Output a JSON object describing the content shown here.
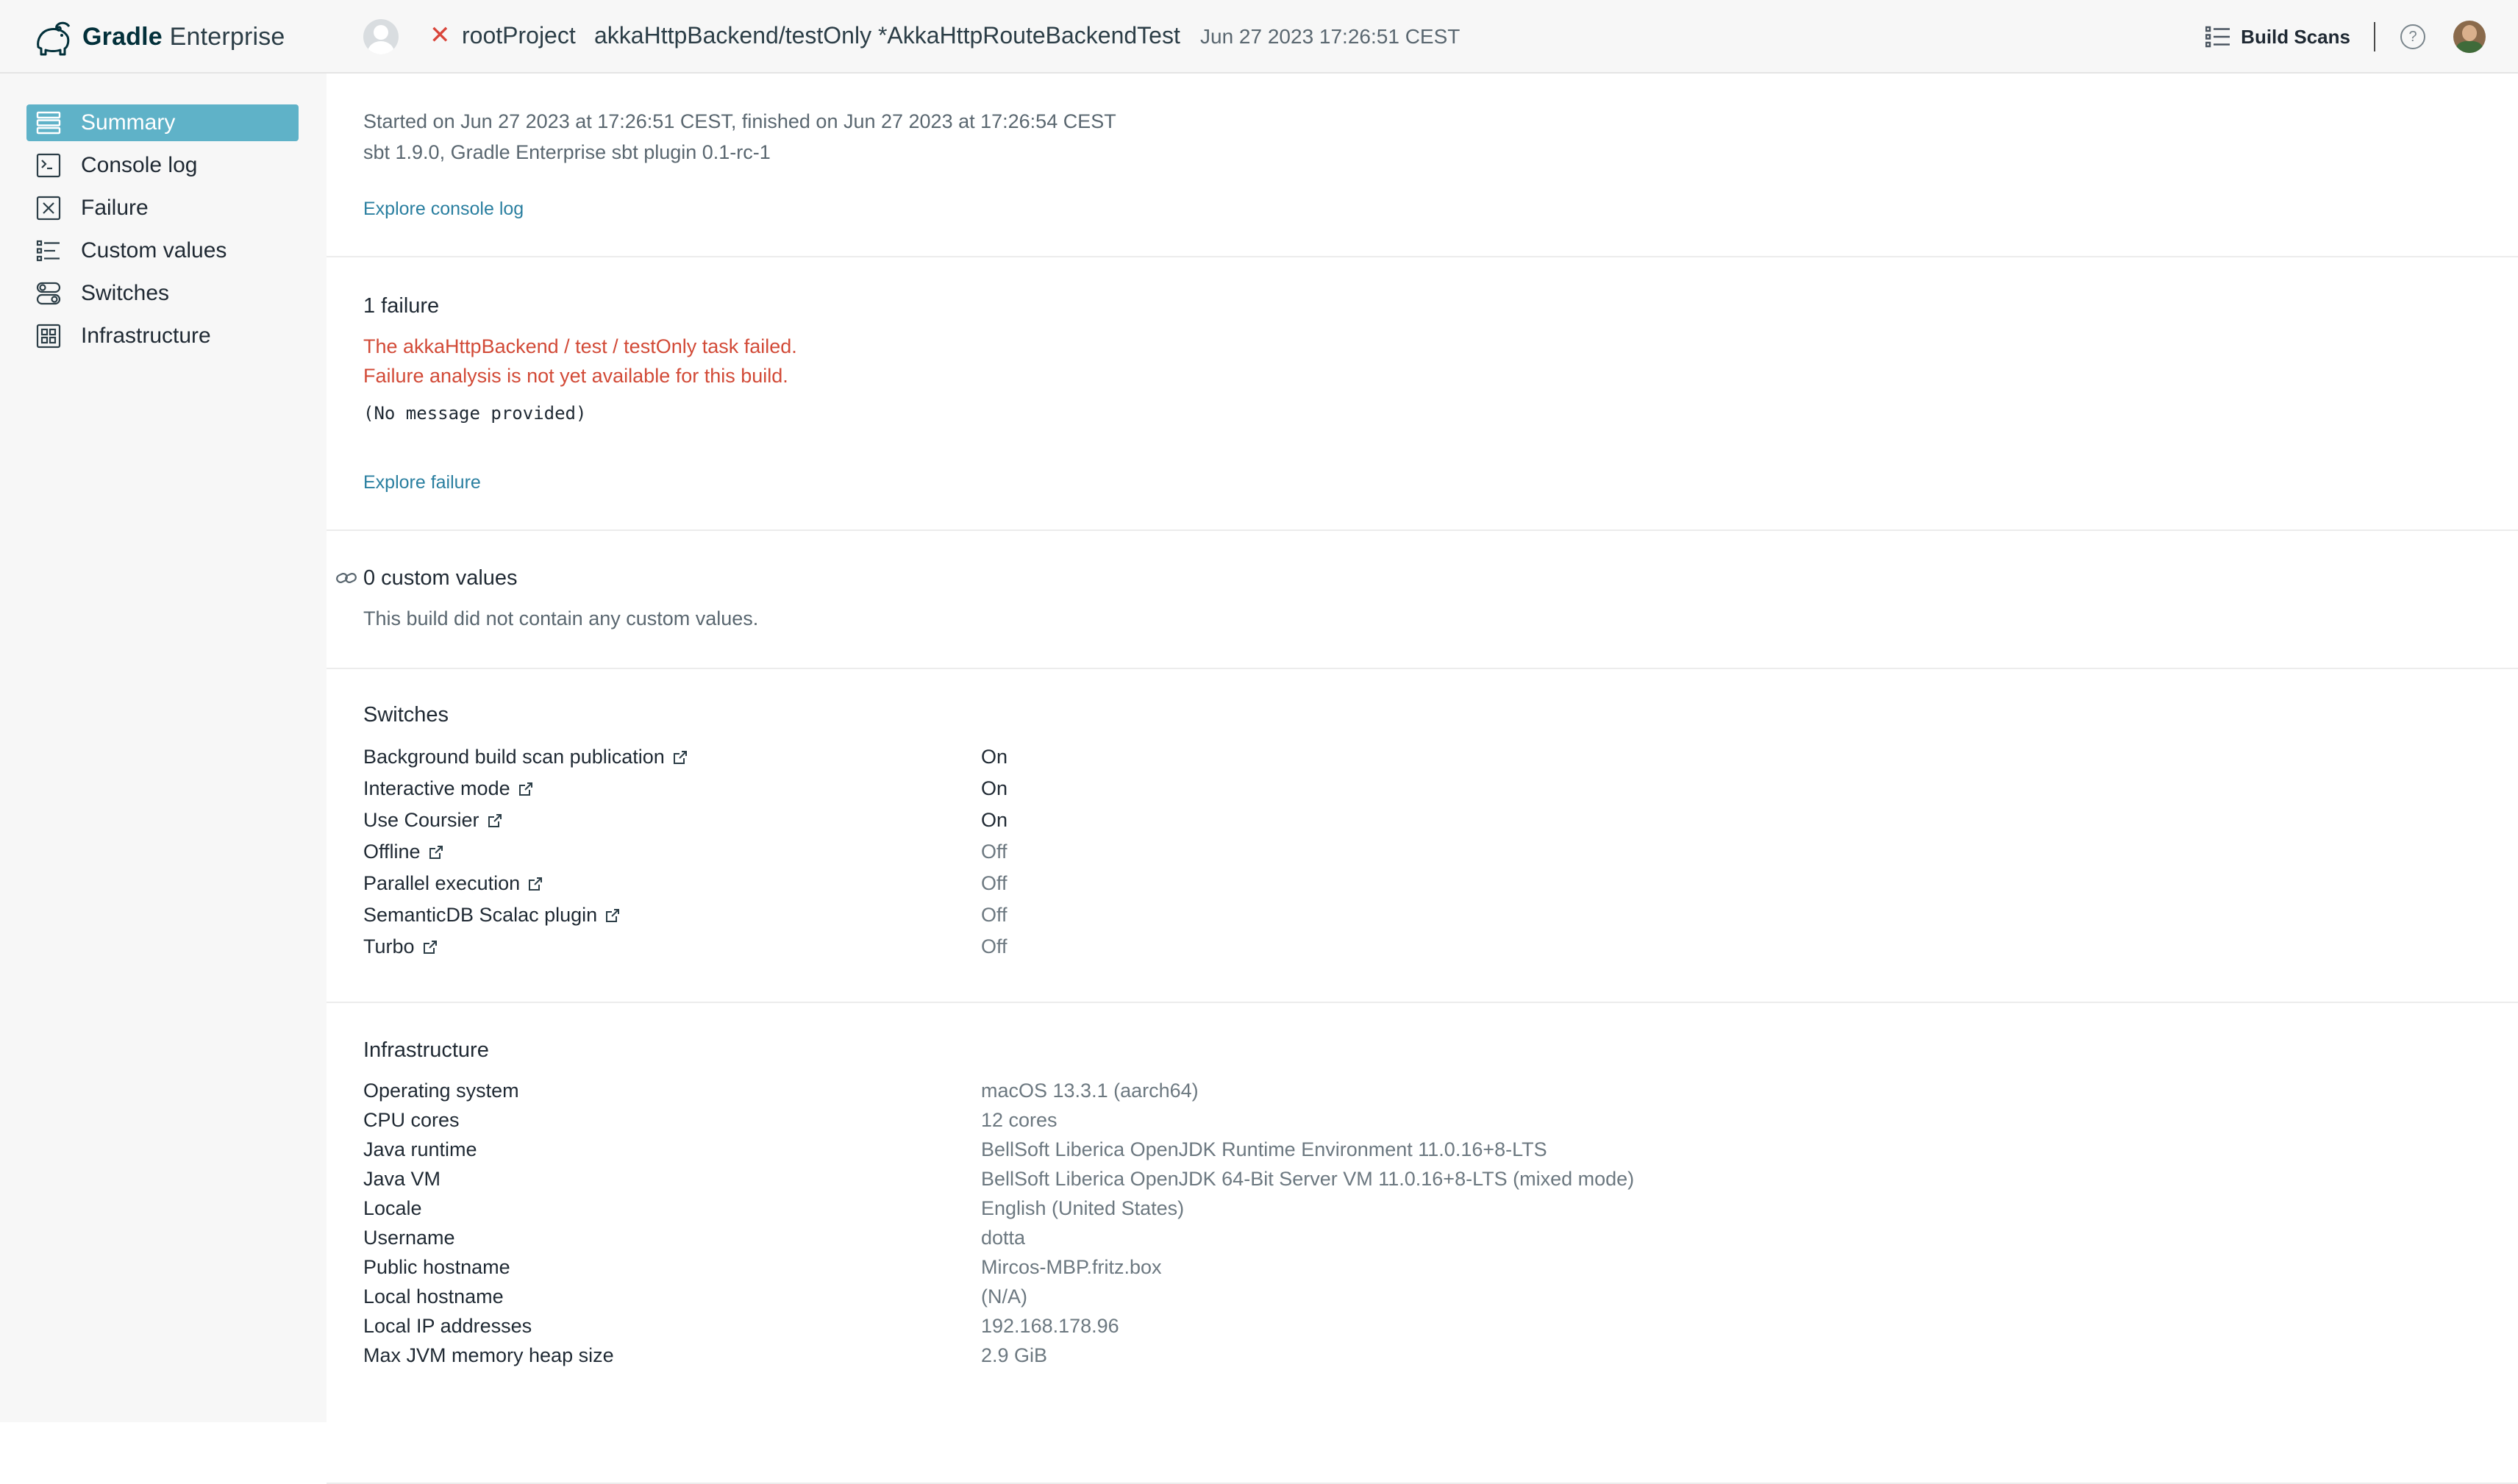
{
  "header": {
    "logo_bold": "Gradle",
    "logo_light": "Enterprise",
    "status_icon": "x-icon",
    "project": "rootProject",
    "task": "akkaHttpBackend/testOnly *AkkaHttpRouteBackendTest",
    "date": "Jun 27 2023 17:26:51 CEST",
    "build_scans_label": "Build Scans",
    "help_label": "?"
  },
  "sidebar": {
    "items": [
      {
        "label": "Summary",
        "icon": "summary-icon",
        "active": true
      },
      {
        "label": "Console log",
        "icon": "console-icon",
        "active": false
      },
      {
        "label": "Failure",
        "icon": "failure-icon",
        "active": false
      },
      {
        "label": "Custom values",
        "icon": "custom-values-icon",
        "active": false
      },
      {
        "label": "Switches",
        "icon": "switches-icon",
        "active": false
      },
      {
        "label": "Infrastructure",
        "icon": "infrastructure-icon",
        "active": false
      }
    ]
  },
  "summary": {
    "started": "Started on Jun 27 2023 at 17:26:51 CEST, finished on Jun 27 2023 at 17:26:54 CEST",
    "tooling": "sbt 1.9.0,  Gradle Enterprise sbt plugin 0.1-rc-1",
    "explore_console": "Explore console log"
  },
  "failure": {
    "title": "1 failure",
    "line1": "The akkaHttpBackend / test / testOnly task failed.",
    "line2": "Failure analysis is not yet available for this build.",
    "message": "(No message provided)",
    "explore": "Explore failure"
  },
  "custom_values": {
    "title": "0 custom values",
    "empty": "This build did not contain any custom values."
  },
  "switches": {
    "title": "Switches",
    "rows": [
      {
        "name": "Background build scan publication",
        "value": "On"
      },
      {
        "name": "Interactive mode",
        "value": "On"
      },
      {
        "name": "Use Coursier",
        "value": "On"
      },
      {
        "name": "Offline",
        "value": "Off"
      },
      {
        "name": "Parallel execution",
        "value": "Off"
      },
      {
        "name": "SemanticDB Scalac plugin",
        "value": "Off"
      },
      {
        "name": "Turbo",
        "value": "Off"
      }
    ]
  },
  "infrastructure": {
    "title": "Infrastructure",
    "rows": [
      {
        "name": "Operating system",
        "value": "macOS 13.3.1 (aarch64)"
      },
      {
        "name": "CPU cores",
        "value": "12 cores"
      },
      {
        "name": "Java runtime",
        "value": "BellSoft Liberica OpenJDK Runtime Environment 11.0.16+8-LTS"
      },
      {
        "name": "Java VM",
        "value": "BellSoft Liberica OpenJDK 64-Bit Server VM 11.0.16+8-LTS (mixed mode)"
      },
      {
        "name": "Locale",
        "value": "English (United States)"
      },
      {
        "name": "Username",
        "value": "dotta"
      },
      {
        "name": "Public hostname",
        "value": "Mircos-MBP.fritz.box"
      },
      {
        "name": "Local hostname",
        "value": "(N/A)"
      },
      {
        "name": "Local IP addresses",
        "value": "192.168.178.96"
      },
      {
        "name": "Max JVM memory heap size",
        "value": "2.9 GiB"
      }
    ]
  },
  "colors": {
    "accent": "#5fb2c8",
    "link": "#2a7fa0",
    "error": "#d24a37"
  }
}
